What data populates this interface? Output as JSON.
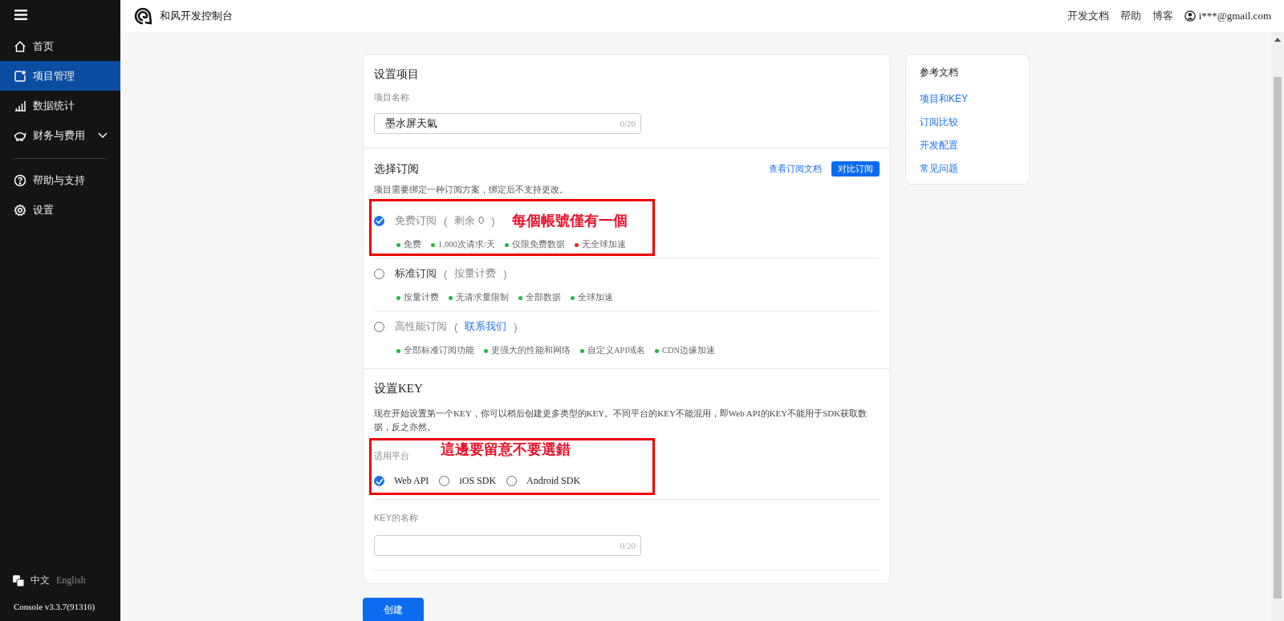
{
  "sidebar": {
    "sections": [
      {
        "items": [
          {
            "label": "首页",
            "selected": false,
            "submenu": false
          },
          {
            "label": "项目管理",
            "selected": true,
            "submenu": false
          },
          {
            "label": "数据统计",
            "selected": false,
            "submenu": false
          },
          {
            "label": "财务与费用",
            "selected": false,
            "submenu": true
          }
        ]
      },
      {
        "items": [
          {
            "label": "帮助与支持",
            "selected": false,
            "submenu": false
          },
          {
            "label": "设置",
            "selected": false,
            "submenu": false
          }
        ]
      }
    ],
    "languages": [
      {
        "label": "中文",
        "selected": true
      },
      {
        "label": "English",
        "selected": false
      }
    ],
    "version": "Console v3.3.7(91316)"
  },
  "topbar": {
    "brand": "和风开发控制台",
    "links": [
      "开发文档",
      "帮助",
      "博客"
    ],
    "account": "i***@gmail.com"
  },
  "project": {
    "title": "设置项目",
    "name_label": "项目名称",
    "name_value": "墨水屏天氣",
    "name_counter": "0/20"
  },
  "subscription": {
    "title": "选择订阅",
    "docs_link": "查看订阅文档",
    "compare_button": "对比订阅",
    "description": "项目需要绑定一种订阅方案，绑定后不支持更改。",
    "plans": [
      {
        "name": "免费订阅",
        "paren_open": "(",
        "note": {
          "kind": "text",
          "text": "剩余 0"
        },
        "paren_close": ")",
        "selected": true,
        "disabled": true,
        "features": [
          {
            "text": "免费",
            "color": "#22b845"
          },
          {
            "text": "1,000次请求/天",
            "color": "#22b845"
          },
          {
            "text": "仅限免费数据",
            "color": "#22b845"
          },
          {
            "text": "无全球加速",
            "color": "#f02020"
          }
        ]
      },
      {
        "name": "标准订阅",
        "paren_open": "(",
        "note": {
          "kind": "text",
          "text": "按量计费"
        },
        "paren_close": ")",
        "selected": false,
        "disabled": false,
        "features": [
          {
            "text": "按量计费",
            "color": "#22b845"
          },
          {
            "text": "无请求量限制",
            "color": "#22b845"
          },
          {
            "text": "全部数据",
            "color": "#22b845"
          },
          {
            "text": "全球加速",
            "color": "#22b845"
          }
        ]
      },
      {
        "name": "高性能订阅",
        "paren_open": "(",
        "note": {
          "kind": "link",
          "text": "联系我们"
        },
        "paren_close": ")",
        "selected": false,
        "disabled": true,
        "features": [
          {
            "text": "全部标准订阅功能",
            "color": "#22b845"
          },
          {
            "text": "更强大的性能和网络",
            "color": "#22b845"
          },
          {
            "text": "自定义API域名",
            "color": "#22b845"
          },
          {
            "text": "CDN边缘加速",
            "color": "#22b845"
          }
        ]
      }
    ]
  },
  "key": {
    "title": "设置KEY",
    "description": "现在开始设置第一个KEY，你可以稍后创建更多类型的KEY。不同平台的KEY不能混用，即Web API的KEY不能用于SDK获取数据，反之亦然。",
    "platform_label": "适用平台",
    "platforms": [
      {
        "label": "Web API",
        "selected": true
      },
      {
        "label": "iOS SDK",
        "selected": false
      },
      {
        "label": "Android SDK",
        "selected": false
      }
    ],
    "name_label": "KEY的名称",
    "name_counter": "0/20"
  },
  "create_button": "创建",
  "reference": {
    "title": "参考文档",
    "links": [
      "项目和KEY",
      "订阅比较",
      "开发配置",
      "常见问题"
    ]
  },
  "annotations": [
    {
      "kind": "plan-note",
      "text": "每個帳號僅有一個"
    },
    {
      "kind": "platform-note",
      "text": "這邊要留意不要選錯"
    }
  ]
}
